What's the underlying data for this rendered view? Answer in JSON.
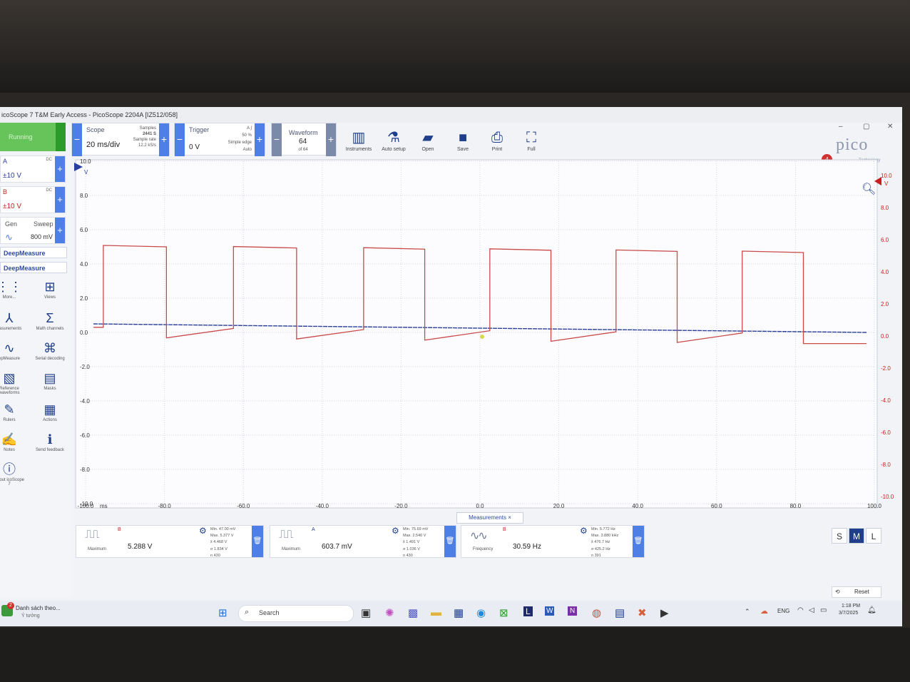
{
  "window": {
    "title": "icoScope 7 T&M Early Access - PicoScope 2204A [IZ512/058]",
    "controls": [
      "–",
      "▢",
      "✕"
    ]
  },
  "toolbar": {
    "status": "Running",
    "scope": {
      "label": "Scope",
      "timebase": "20 ms/div",
      "samples_label": "Samples",
      "samples": "2441 S",
      "rate_label": "Sample rate",
      "rate": "12.2 kS/s"
    },
    "trigger": {
      "label": "Trigger",
      "level": "0 V",
      "channel": "A  ∫",
      "pct": "50 %",
      "type": "Simple edge",
      "mode": "Auto"
    },
    "waveform": {
      "label": "Waveform",
      "index": "64",
      "of": "of 64"
    },
    "tools": [
      "Instruments",
      "Auto setup",
      "Open",
      "Save",
      "Print",
      "Full"
    ],
    "notification_count": "4",
    "brand": "pico",
    "brand_sub": "Technology"
  },
  "channels": [
    {
      "name": "A",
      "coupling": "DC",
      "probe": "x10",
      "range": "±10 V",
      "color": "#2b3f9e"
    },
    {
      "name": "B",
      "coupling": "DC",
      "probe": "x10",
      "range": "±10 V",
      "color": "#c81e1e"
    }
  ],
  "generator": {
    "label": "Gen",
    "mode": "Sweep",
    "amplitude": "800 mV"
  },
  "deepmeasure": [
    "DeepMeasure",
    "DeepMeasure"
  ],
  "left_tools": [
    {
      "label": "More...",
      "icon": "grid-icon"
    },
    {
      "label": "Views",
      "icon": "views-icon"
    },
    {
      "label": "easurements",
      "icon": "measure-icon"
    },
    {
      "label": "Math channels",
      "icon": "sigma-icon"
    },
    {
      "label": "epMeasure",
      "icon": "deepmeasure-icon"
    },
    {
      "label": "Serial decoding",
      "icon": "serial-icon"
    },
    {
      "label": "Reference waveforms",
      "icon": "reference-icon"
    },
    {
      "label": "Masks",
      "icon": "mask-icon"
    },
    {
      "label": "Rulers",
      "icon": "ruler-icon"
    },
    {
      "label": "Actions",
      "icon": "clapper-icon"
    },
    {
      "label": "Notes",
      "icon": "notes-icon"
    },
    {
      "label": "Send feedback",
      "icon": "feedback-icon"
    },
    {
      "label": "About icoScope 7",
      "icon": "info-icon"
    }
  ],
  "axes": {
    "left_unit": "V",
    "left_ticks": [
      "10.0",
      "8.0",
      "6.0",
      "4.0",
      "2.0",
      "0.0",
      "-2.0",
      "-4.0",
      "-6.0",
      "-8.0",
      "-10.0"
    ],
    "right_unit": "V",
    "right_ticks": [
      "10.0",
      "8.0",
      "6.0",
      "4.0",
      "2.0",
      "0.0",
      "-2.0",
      "-4.0",
      "-6.0",
      "-8.0",
      "-10.0"
    ],
    "x_ticks": [
      "-100.0",
      "-80.0",
      "-60.0",
      "-40.0",
      "-20.0",
      "0.0",
      "20.0",
      "40.0",
      "60.0",
      "80.0",
      "100.0"
    ],
    "x_unit": "ms"
  },
  "chart_data": {
    "type": "line",
    "xlim": [
      -100,
      100
    ],
    "ylim": [
      -10,
      10
    ],
    "grid": true,
    "series": [
      {
        "name": "B",
        "color": "#c84a4a",
        "high_segments": [
          [
            -95.5,
            -79.5
          ],
          [
            -62.5,
            -46.5
          ],
          [
            -29.5,
            -14
          ],
          [
            2.5,
            18
          ],
          [
            34.5,
            50
          ],
          [
            66.5,
            82
          ]
        ],
        "high": 5.0,
        "low": -0.15
      },
      {
        "name": "A",
        "color": "#2b3f9e",
        "level": 0.5
      }
    ],
    "trigger_marker": {
      "x": 0.0,
      "y": 0.0
    }
  },
  "measurements_tab": "Measurements",
  "measurements": [
    {
      "channel": "B",
      "kind": "Maximum",
      "value": "5.288 V",
      "stats": [
        "Min.  47.00 mV",
        "Max.  5.377 V",
        "x̄     4.468 V",
        "σ     1.834 V",
        "n     430"
      ]
    },
    {
      "channel": "A",
      "kind": "Maximum",
      "value": "603.7 mV",
      "stats": [
        "Min.  75.69 mV",
        "Max.  2.540 V",
        "x̄     1.491 V",
        "σ     1.036 V",
        "n     430"
      ]
    },
    {
      "channel": "B",
      "kind": "Frequency",
      "value": "30.59 Hz",
      "stats": [
        "Min.  5.772 Hz",
        "Max.  3.880 kHz",
        "x̄     476.7 Hz",
        "σ     425.2 Hz",
        "n     391"
      ]
    }
  ],
  "size_buttons": [
    "S",
    "M",
    "L"
  ],
  "reset_label": "Reset",
  "taskbar": {
    "news_title": "Danh sách theo...",
    "news_sub": "Ý tưởng",
    "news_badge": "2",
    "search_placeholder": "Search",
    "lang": "ENG",
    "time": "1:18 PM",
    "date": "3/7/2025"
  }
}
